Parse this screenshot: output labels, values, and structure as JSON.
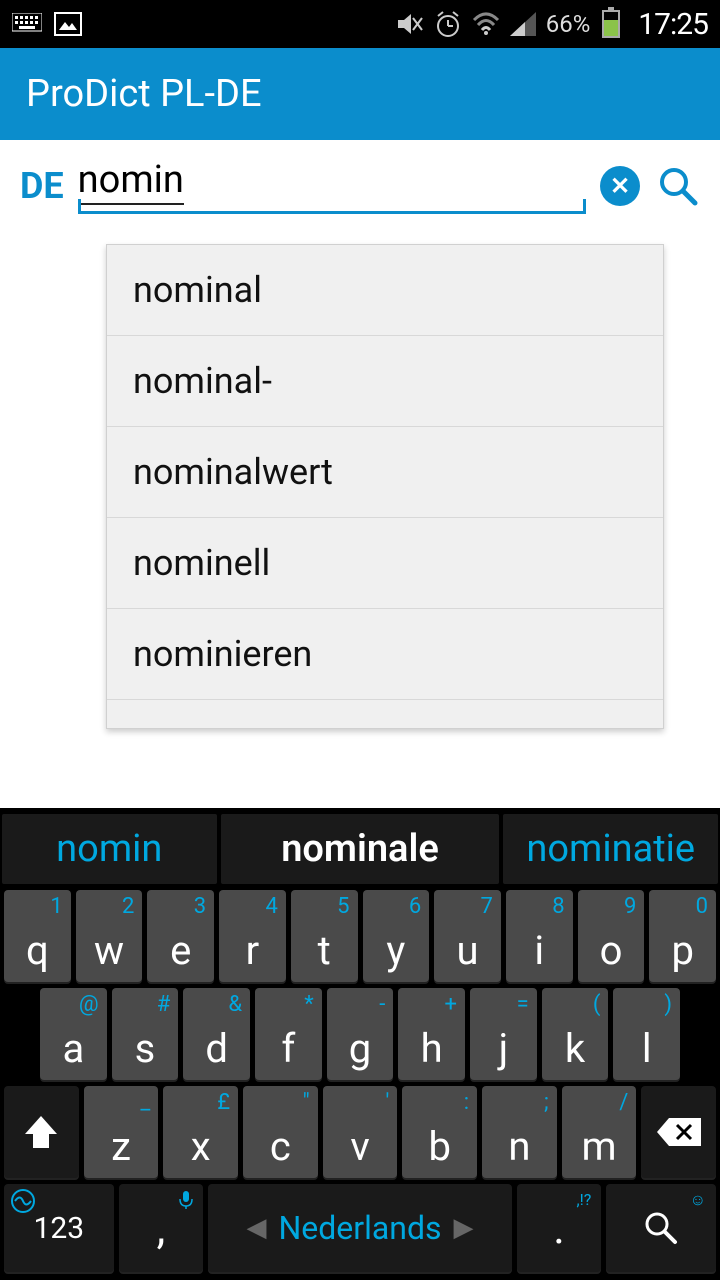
{
  "status": {
    "battery_pct": "66%",
    "time": "17:25"
  },
  "app": {
    "title": "ProDict PL-DE"
  },
  "search": {
    "lang": "DE",
    "value": "nomin"
  },
  "suggestions": [
    "nominal",
    "nominal-",
    "nominalwert",
    "nominell",
    "nominieren"
  ],
  "predictions": {
    "left": "nomin",
    "center": "nominale",
    "right": "nominatie"
  },
  "keyboard": {
    "row1": [
      {
        "main": "q",
        "alt": "1"
      },
      {
        "main": "w",
        "alt": "2"
      },
      {
        "main": "e",
        "alt": "3"
      },
      {
        "main": "r",
        "alt": "4"
      },
      {
        "main": "t",
        "alt": "5"
      },
      {
        "main": "y",
        "alt": "6"
      },
      {
        "main": "u",
        "alt": "7"
      },
      {
        "main": "i",
        "alt": "8"
      },
      {
        "main": "o",
        "alt": "9"
      },
      {
        "main": "p",
        "alt": "0"
      }
    ],
    "row2": [
      {
        "main": "a",
        "alt": "@"
      },
      {
        "main": "s",
        "alt": "#"
      },
      {
        "main": "d",
        "alt": "&"
      },
      {
        "main": "f",
        "alt": "*"
      },
      {
        "main": "g",
        "alt": "-"
      },
      {
        "main": "h",
        "alt": "+"
      },
      {
        "main": "j",
        "alt": "="
      },
      {
        "main": "k",
        "alt": "("
      },
      {
        "main": "l",
        "alt": ")"
      }
    ],
    "row3": [
      {
        "main": "z",
        "alt": "_"
      },
      {
        "main": "x",
        "alt": "£"
      },
      {
        "main": "c",
        "alt": "\""
      },
      {
        "main": "v",
        "alt": "'"
      },
      {
        "main": "b",
        "alt": ":"
      },
      {
        "main": "n",
        "alt": ";"
      },
      {
        "main": "m",
        "alt": "/"
      }
    ],
    "numKey": "123",
    "comma": ",",
    "space": "Nederlands",
    "period": ".",
    "periodAlt": ",!?",
    "smiley": "☺"
  }
}
